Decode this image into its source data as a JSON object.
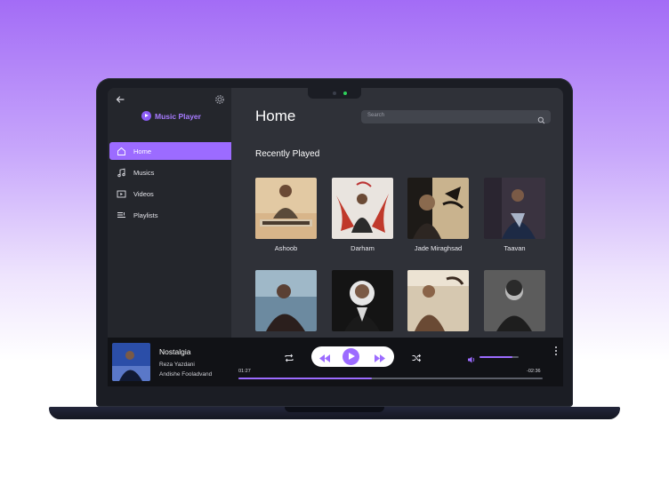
{
  "app": {
    "name": "Music Player"
  },
  "sidebar": {
    "items": [
      {
        "label": "Home",
        "icon": "home-icon",
        "active": true
      },
      {
        "label": "Musics",
        "icon": "music-note-icon",
        "active": false
      },
      {
        "label": "Videos",
        "icon": "video-icon",
        "active": false
      },
      {
        "label": "Playlists",
        "icon": "playlist-icon",
        "active": false
      }
    ]
  },
  "main": {
    "title": "Home",
    "search_placeholder": "Search",
    "section_title": "Recently Played",
    "albums": [
      {
        "title": "Ashoob"
      },
      {
        "title": "Darham"
      },
      {
        "title": "Jade Miraghsad"
      },
      {
        "title": "Taavan"
      },
      {
        "title": ""
      },
      {
        "title": ""
      },
      {
        "title": ""
      },
      {
        "title": ""
      }
    ]
  },
  "player": {
    "track_title": "Nostalgia",
    "artist": "Reza Yazdani",
    "artist2": "Andishe Fooladvand",
    "time_current": "01:27",
    "time_remaining": "-02:36",
    "progress": 0.44,
    "volume": 0.85
  },
  "colors": {
    "accent": "#9c6bff",
    "brand": "#a77bff",
    "sidebar_bg": "#24262c",
    "main_bg": "#2f3138",
    "player_bg": "#111216"
  }
}
